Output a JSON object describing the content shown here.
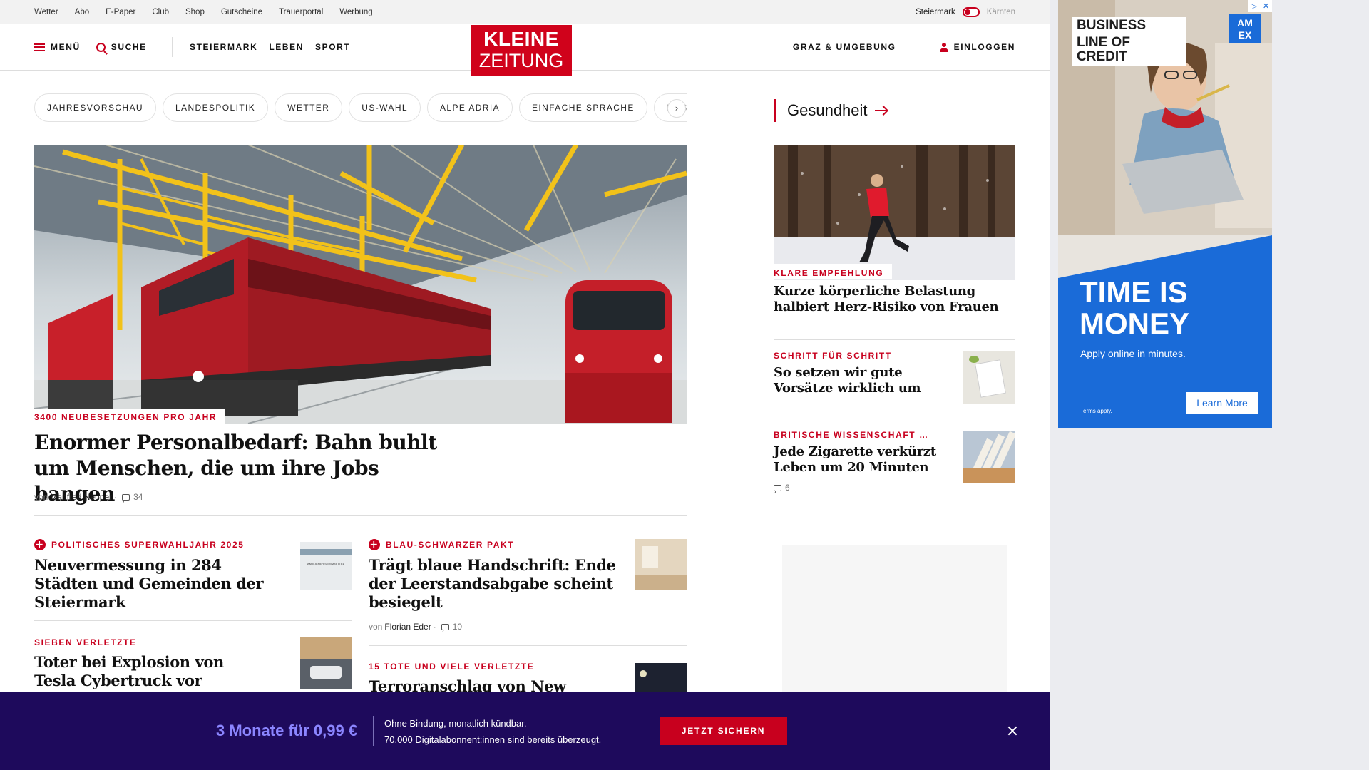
{
  "utility": {
    "links": [
      "Wetter",
      "Abo",
      "E-Paper",
      "Club",
      "Shop",
      "Gutscheine",
      "Trauerportal",
      "Werbung"
    ],
    "region_active": "Steiermark",
    "region_inactive": "Kärnten"
  },
  "header": {
    "menu_label": "MENÜ",
    "search_label": "SUCHE",
    "sections": [
      "STEIERMARK",
      "LEBEN",
      "SPORT"
    ],
    "logo_line1": "KLEINE",
    "logo_line2": "ZEITUNG",
    "local_label": "GRAZ & UMGEBUNG",
    "login_label": "EINLOGGEN"
  },
  "chips": [
    "JAHRESVORSCHAU",
    "LANDESPOLITIK",
    "WETTER",
    "US-WAHL",
    "ALPE ADRIA",
    "EINFACHE SPRACHE",
    "DOS"
  ],
  "hero": {
    "kicker": "3400 NEUBESETZUNGEN PRO JAHR",
    "title": "Enormer Personalbedarf: Bahn buhlt um Menschen, die um ihre Jobs bangen",
    "by_prefix": "von",
    "author": "Manfred Neuper",
    "comments": "34"
  },
  "articles": [
    {
      "kicker": "POLITISCHES SUPERWAHLJAHR 2025",
      "plus": true,
      "title": "Neuvermessung in 284 Städten und Gemeinden der Steiermark"
    },
    {
      "kicker": "BLAU-SCHWARZER PAKT",
      "plus": true,
      "title": "Trägt blaue Handschrift: Ende der Leerstandsabgabe scheint besiegelt",
      "by_prefix": "von",
      "author": "Florian Eder",
      "comments": "10"
    },
    {
      "kicker": "SIEBEN VERLETZTE",
      "plus": false,
      "title": "Toter bei Explosion von Tesla Cybertruck vor"
    },
    {
      "kicker": "15 TOTE UND VIELE VERLETZTE",
      "plus": false,
      "title": "Terroranschlag von New Orleans:"
    }
  ],
  "thumb_text": "AMTLICHER STIMMZETTEL",
  "sidebar": {
    "section_title": "Gesundheit",
    "lead": {
      "kicker": "KLARE EMPFEHLUNG",
      "title": "Kurze körperliche Belastung halbiert Herz-Risiko von Frauen"
    },
    "items": [
      {
        "kicker": "SCHRITT FÜR SCHRITT",
        "title": "So setzen wir gute Vorsätze wirklich um"
      },
      {
        "kicker": "BRITISCHE WISSENSCHAFT …",
        "title": "Jede Zigarette verkürzt Leben um 20 Minuten",
        "comments": "6"
      }
    ]
  },
  "subscribe": {
    "offer": "3 Monate für 0,99 €",
    "line1": "Ohne Bindung, monatlich kündbar.",
    "line2": "70.000 Digitalabonnent:innen sind bereits überzeugt.",
    "button": "JETZT SICHERN"
  },
  "ad": {
    "headline_1": "BUSINESS",
    "headline_2": "LINE OF CREDIT",
    "brand_1": "AM",
    "brand_2": "EX",
    "big_1": "TIME IS",
    "big_2": "MONEY",
    "sub": "Apply online in minutes.",
    "terms": "Terms apply.",
    "button": "Learn More"
  },
  "colors": {
    "brand_red": "#c8001e",
    "promo_bg": "#1e0a5c",
    "promo_accent": "#8b85ff",
    "ad_blue": "#1a6bd8"
  }
}
